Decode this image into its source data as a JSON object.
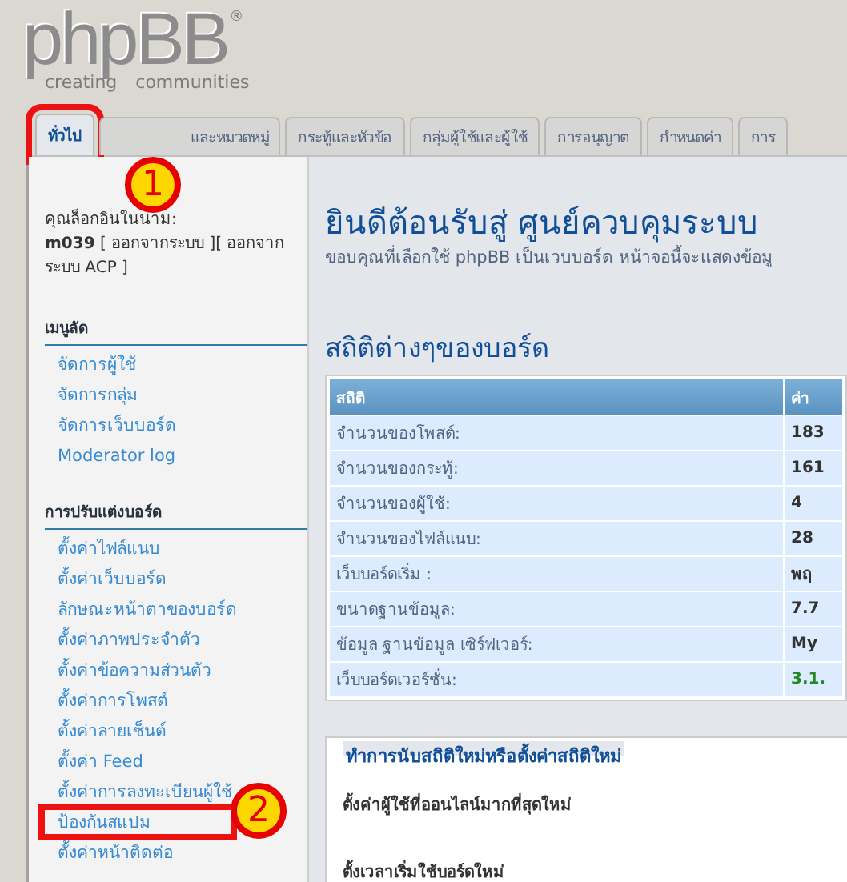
{
  "logo": {
    "name": "phpBB",
    "mark": "®",
    "tagline": "creating communities"
  },
  "tabs": [
    {
      "label": "ทั่วไป",
      "selected": true,
      "highlighted": true,
      "marker": "1"
    },
    {
      "label": "และหมวดหมู่",
      "selected": false,
      "highlighted": false
    },
    {
      "label": "กระทู้และหัวข้อ",
      "selected": false,
      "highlighted": false
    },
    {
      "label": "กลุ่มผู้ใช้และผู้ใช้",
      "selected": false,
      "highlighted": false
    },
    {
      "label": "การอนุญาต",
      "selected": false,
      "highlighted": false
    },
    {
      "label": "กำหนดค่า",
      "selected": false,
      "highlighted": false
    },
    {
      "label": "การ",
      "selected": false,
      "highlighted": false
    }
  ],
  "sidebar": {
    "login_label": "คุณล็อกอินในนาม:",
    "username": "m039",
    "logout": "[ ออกจากระบบ ]",
    "logout_acp": "[ ออกจากระบบ ACP ]",
    "sections": [
      {
        "title": "เมนูลัด",
        "items": [
          {
            "label": "จัดการผู้ใช้",
            "highlighted": false
          },
          {
            "label": "จัดการกลุ่ม",
            "highlighted": false
          },
          {
            "label": "จัดการเว็บบอร์ด",
            "highlighted": false
          },
          {
            "label": "Moderator log",
            "highlighted": false
          }
        ]
      },
      {
        "title": "การปรับแต่งบอร์ด",
        "items": [
          {
            "label": "ตั้งค่าไฟล์แนบ",
            "highlighted": false
          },
          {
            "label": "ตั้งค่าเว็บบอร์ด",
            "highlighted": false
          },
          {
            "label": "ลักษณะหน้าตาของบอร์ด",
            "highlighted": false
          },
          {
            "label": "ตั้งค่าภาพประจำตัว",
            "highlighted": false
          },
          {
            "label": "ตั้งค่าข้อความส่วนตัว",
            "highlighted": false
          },
          {
            "label": "ตั้งค่าการโพสต์",
            "highlighted": false
          },
          {
            "label": "ตั้งค่าลายเซ็นต์",
            "highlighted": false
          },
          {
            "label": "ตั้งค่า Feed",
            "highlighted": false
          },
          {
            "label": "ตั้งค่าการลงทะเบียนผู้ใช้",
            "highlighted": false
          },
          {
            "label": "ป้องกันสแปม",
            "highlighted": true,
            "marker": "2"
          },
          {
            "label": "ตั้งค่าหน้าติดต่อ",
            "highlighted": false
          }
        ]
      }
    ]
  },
  "content": {
    "title": "ยินดีต้อนรับสู่ ศูนย์ควบคุมระบบ",
    "subtitle": "ขอบคุณที่เลือกใช้ phpBB เป็นเวบบอร์ด หน้าจอนี้จะแสดงข้อมู",
    "stats_title": "สถิติต่างๆของบอร์ด",
    "table": {
      "columns": [
        "สถิติ",
        "ค่า"
      ],
      "rows": [
        {
          "label": "จำนวนของโพสต์:",
          "value": "183",
          "kind": "plain"
        },
        {
          "label": "จำนวนของกระทู้:",
          "value": "161",
          "kind": "plain"
        },
        {
          "label": "จำนวนของผู้ใช้:",
          "value": "4",
          "kind": "plain"
        },
        {
          "label": "จำนวนของไฟล์แนบ:",
          "value": "28",
          "kind": "plain"
        },
        {
          "label": "เว็บบอร์ดเริ่ม :",
          "value": "พฤ",
          "kind": "plain"
        },
        {
          "label": "ขนาดฐานข้อมูล:",
          "value": "7.7",
          "kind": "plain"
        },
        {
          "label": "ข้อมูล ฐานข้อมูล เซิร์ฟเวอร์:",
          "value": "My",
          "kind": "plain"
        },
        {
          "label": "เว็บบอร์ดเวอร์ชั่น:",
          "value": "3.1.",
          "kind": "version"
        }
      ]
    },
    "reset": {
      "legend": "ทำการนับสถิติใหม่หรือตั้งค่าสถิติใหม่",
      "items": [
        "ตั้งค่าผู้ใช้ที่ออนไลน์มากที่สุดใหม่",
        "ตั้งเวลาเริ่มใช้บอร์ดใหม่"
      ]
    }
  }
}
